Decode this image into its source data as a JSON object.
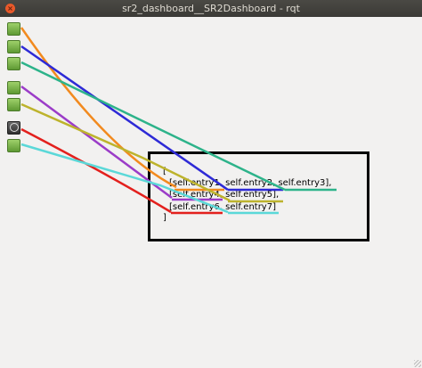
{
  "window": {
    "title": "sr2_dashboard__SR2Dashboard - rqt",
    "close_glyph": "×"
  },
  "sidebar": {
    "icons": [
      {
        "name": "status-indicator-1",
        "color": "#7fbf4d"
      },
      {
        "name": "status-indicator-2",
        "color": "#7fbf4d"
      },
      {
        "name": "status-indicator-3",
        "color": "#7fbf4d"
      },
      {
        "name": "status-indicator-4",
        "color": "#7fbf4d"
      },
      {
        "name": "status-indicator-5",
        "color": "#7fbf4d"
      },
      {
        "name": "special-plugin-icon",
        "color": "#3a3a3a"
      },
      {
        "name": "status-indicator-6",
        "color": "#7fbf4d"
      }
    ]
  },
  "code": {
    "open_bracket": "[",
    "line1": "[self.entry1, self.entry2, self.entry3],",
    "line2": "[self.entry4, self.entry5],",
    "line3": "[self.entry6, self.entry7]",
    "close_bracket": "]"
  },
  "annotation_colors": {
    "orange": "#f28a1e",
    "blue": "#2e2ad6",
    "green": "#2db38a",
    "purple": "#9b3cc8",
    "olive": "#bdb32c",
    "red": "#e3201d",
    "cyan": "#5bd8d8"
  }
}
